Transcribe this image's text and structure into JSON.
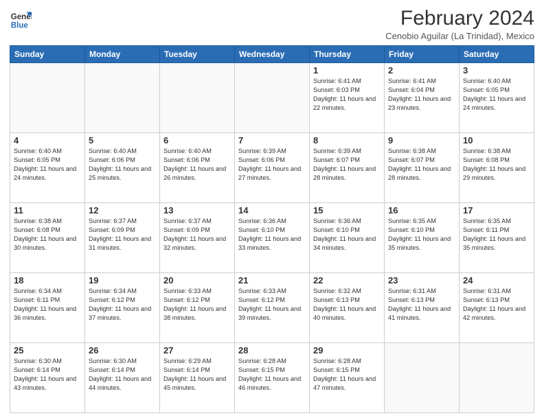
{
  "header": {
    "logo_line1": "General",
    "logo_line2": "Blue",
    "main_title": "February 2024",
    "subtitle": "Cenobio Aguilar (La Trinidad), Mexico"
  },
  "weekdays": [
    "Sunday",
    "Monday",
    "Tuesday",
    "Wednesday",
    "Thursday",
    "Friday",
    "Saturday"
  ],
  "weeks": [
    [
      {
        "day": "",
        "info": ""
      },
      {
        "day": "",
        "info": ""
      },
      {
        "day": "",
        "info": ""
      },
      {
        "day": "",
        "info": ""
      },
      {
        "day": "1",
        "info": "Sunrise: 6:41 AM\nSunset: 6:03 PM\nDaylight: 11 hours and 22 minutes."
      },
      {
        "day": "2",
        "info": "Sunrise: 6:41 AM\nSunset: 6:04 PM\nDaylight: 11 hours and 23 minutes."
      },
      {
        "day": "3",
        "info": "Sunrise: 6:40 AM\nSunset: 6:05 PM\nDaylight: 11 hours and 24 minutes."
      }
    ],
    [
      {
        "day": "4",
        "info": "Sunrise: 6:40 AM\nSunset: 6:05 PM\nDaylight: 11 hours and 24 minutes."
      },
      {
        "day": "5",
        "info": "Sunrise: 6:40 AM\nSunset: 6:06 PM\nDaylight: 11 hours and 25 minutes."
      },
      {
        "day": "6",
        "info": "Sunrise: 6:40 AM\nSunset: 6:06 PM\nDaylight: 11 hours and 26 minutes."
      },
      {
        "day": "7",
        "info": "Sunrise: 6:39 AM\nSunset: 6:06 PM\nDaylight: 11 hours and 27 minutes."
      },
      {
        "day": "8",
        "info": "Sunrise: 6:39 AM\nSunset: 6:07 PM\nDaylight: 11 hours and 28 minutes."
      },
      {
        "day": "9",
        "info": "Sunrise: 6:38 AM\nSunset: 6:07 PM\nDaylight: 11 hours and 28 minutes."
      },
      {
        "day": "10",
        "info": "Sunrise: 6:38 AM\nSunset: 6:08 PM\nDaylight: 11 hours and 29 minutes."
      }
    ],
    [
      {
        "day": "11",
        "info": "Sunrise: 6:38 AM\nSunset: 6:08 PM\nDaylight: 11 hours and 30 minutes."
      },
      {
        "day": "12",
        "info": "Sunrise: 6:37 AM\nSunset: 6:09 PM\nDaylight: 11 hours and 31 minutes."
      },
      {
        "day": "13",
        "info": "Sunrise: 6:37 AM\nSunset: 6:09 PM\nDaylight: 11 hours and 32 minutes."
      },
      {
        "day": "14",
        "info": "Sunrise: 6:36 AM\nSunset: 6:10 PM\nDaylight: 11 hours and 33 minutes."
      },
      {
        "day": "15",
        "info": "Sunrise: 6:36 AM\nSunset: 6:10 PM\nDaylight: 11 hours and 34 minutes."
      },
      {
        "day": "16",
        "info": "Sunrise: 6:35 AM\nSunset: 6:10 PM\nDaylight: 11 hours and 35 minutes."
      },
      {
        "day": "17",
        "info": "Sunrise: 6:35 AM\nSunset: 6:11 PM\nDaylight: 11 hours and 35 minutes."
      }
    ],
    [
      {
        "day": "18",
        "info": "Sunrise: 6:34 AM\nSunset: 6:11 PM\nDaylight: 11 hours and 36 minutes."
      },
      {
        "day": "19",
        "info": "Sunrise: 6:34 AM\nSunset: 6:12 PM\nDaylight: 11 hours and 37 minutes."
      },
      {
        "day": "20",
        "info": "Sunrise: 6:33 AM\nSunset: 6:12 PM\nDaylight: 11 hours and 38 minutes."
      },
      {
        "day": "21",
        "info": "Sunrise: 6:33 AM\nSunset: 6:12 PM\nDaylight: 11 hours and 39 minutes."
      },
      {
        "day": "22",
        "info": "Sunrise: 6:32 AM\nSunset: 6:13 PM\nDaylight: 11 hours and 40 minutes."
      },
      {
        "day": "23",
        "info": "Sunrise: 6:31 AM\nSunset: 6:13 PM\nDaylight: 11 hours and 41 minutes."
      },
      {
        "day": "24",
        "info": "Sunrise: 6:31 AM\nSunset: 6:13 PM\nDaylight: 11 hours and 42 minutes."
      }
    ],
    [
      {
        "day": "25",
        "info": "Sunrise: 6:30 AM\nSunset: 6:14 PM\nDaylight: 11 hours and 43 minutes."
      },
      {
        "day": "26",
        "info": "Sunrise: 6:30 AM\nSunset: 6:14 PM\nDaylight: 11 hours and 44 minutes."
      },
      {
        "day": "27",
        "info": "Sunrise: 6:29 AM\nSunset: 6:14 PM\nDaylight: 11 hours and 45 minutes."
      },
      {
        "day": "28",
        "info": "Sunrise: 6:28 AM\nSunset: 6:15 PM\nDaylight: 11 hours and 46 minutes."
      },
      {
        "day": "29",
        "info": "Sunrise: 6:28 AM\nSunset: 6:15 PM\nDaylight: 11 hours and 47 minutes."
      },
      {
        "day": "",
        "info": ""
      },
      {
        "day": "",
        "info": ""
      }
    ]
  ]
}
